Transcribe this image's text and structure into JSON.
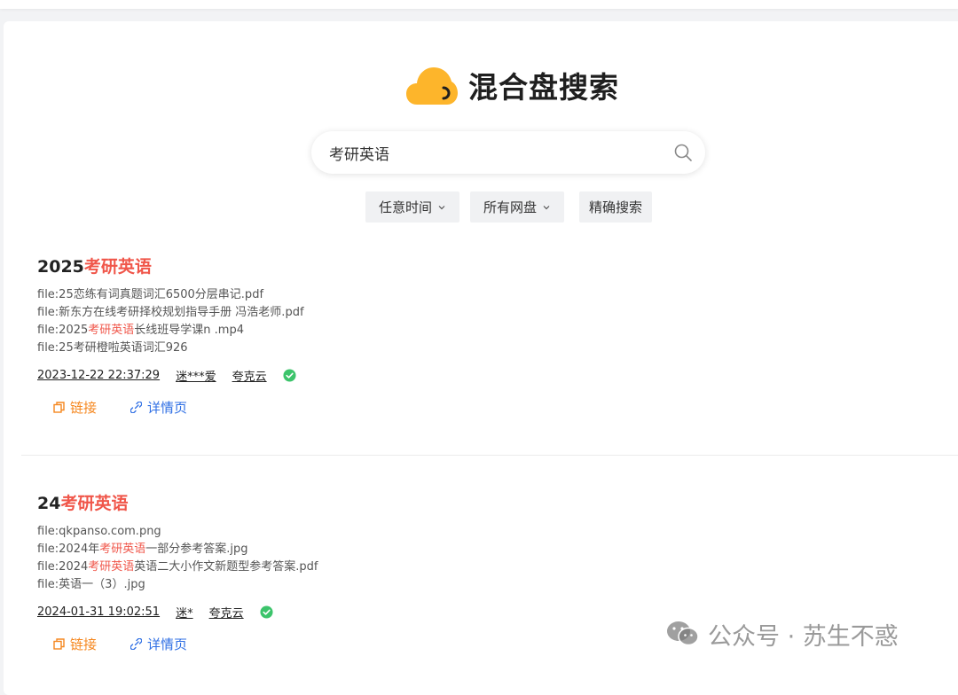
{
  "header": {
    "title": "混合盘搜索",
    "logo_icon": "cloud-logo-icon",
    "brand_color": "#fdb52b"
  },
  "search": {
    "value": "考研英语",
    "placeholder": ""
  },
  "filters": {
    "time": "任意时间",
    "disk": "所有网盘",
    "exact": "精确搜索"
  },
  "results": [
    {
      "title_prefix": "2025",
      "title_highlight": "考研英语",
      "files": [
        {
          "pre": "file:25恋练有词真题词汇6500分层串记.pdf",
          "hl": "",
          "post": ""
        },
        {
          "pre": "file:新东方在线考研择校规划指导手册 冯浩老师.pdf",
          "hl": "",
          "post": ""
        },
        {
          "pre": "file:2025",
          "hl": "考研英语",
          "post": "长线班导学课n .mp4"
        },
        {
          "pre": "file:25考研橙啦英语词汇926",
          "hl": "",
          "post": ""
        }
      ],
      "date": "2023-12-22 22:37:29",
      "user": "迷***爱",
      "disk": "夸克云",
      "link_label": "链接",
      "detail_label": "详情页"
    },
    {
      "title_prefix": "24",
      "title_highlight": "考研英语",
      "files": [
        {
          "pre": "file:qkpanso.com.png",
          "hl": "",
          "post": ""
        },
        {
          "pre": "file:2024年",
          "hl": "考研英语",
          "post": "一部分参考答案.jpg"
        },
        {
          "pre": "file:2024",
          "hl": "考研英语",
          "post": "英语二大小作文新题型参考答案.pdf"
        },
        {
          "pre": "file:英语一（3）.jpg",
          "hl": "",
          "post": ""
        }
      ],
      "date": "2024-01-31 19:02:51",
      "user": "迷*",
      "disk": "夸克云",
      "link_label": "链接",
      "detail_label": "详情页"
    }
  ],
  "watermark": {
    "text": "公众号 · 苏生不惑"
  },
  "colors": {
    "highlight": "#f0564a",
    "link": "#f5871f",
    "detail": "#2f6fe4",
    "verified": "#3cc46b"
  }
}
